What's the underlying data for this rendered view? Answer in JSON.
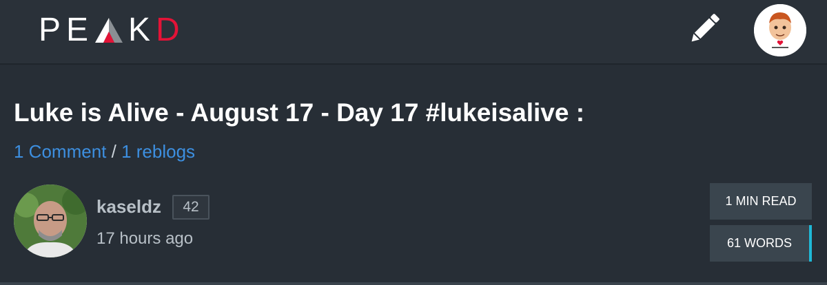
{
  "header": {
    "logo_prefix": "PE",
    "logo_suffix_k": "K",
    "logo_suffix_d": "D",
    "brand_color": "#e31337",
    "compose_icon": "pencil-icon",
    "user_avatar": "user-avatar"
  },
  "post": {
    "title": "Luke is Alive - August 17 - Day 17 #lukeisalive :",
    "comments_label": "1 Comment",
    "separator": "/",
    "reblogs_label": "1 reblogs",
    "author": "kaseldz",
    "reputation": "42",
    "time": "17 hours ago",
    "read_time": "1 MIN READ",
    "word_count": "61 WORDS"
  },
  "colors": {
    "background": "#272e36",
    "link": "#3d8fe0",
    "accent": "#1fb8d6"
  }
}
